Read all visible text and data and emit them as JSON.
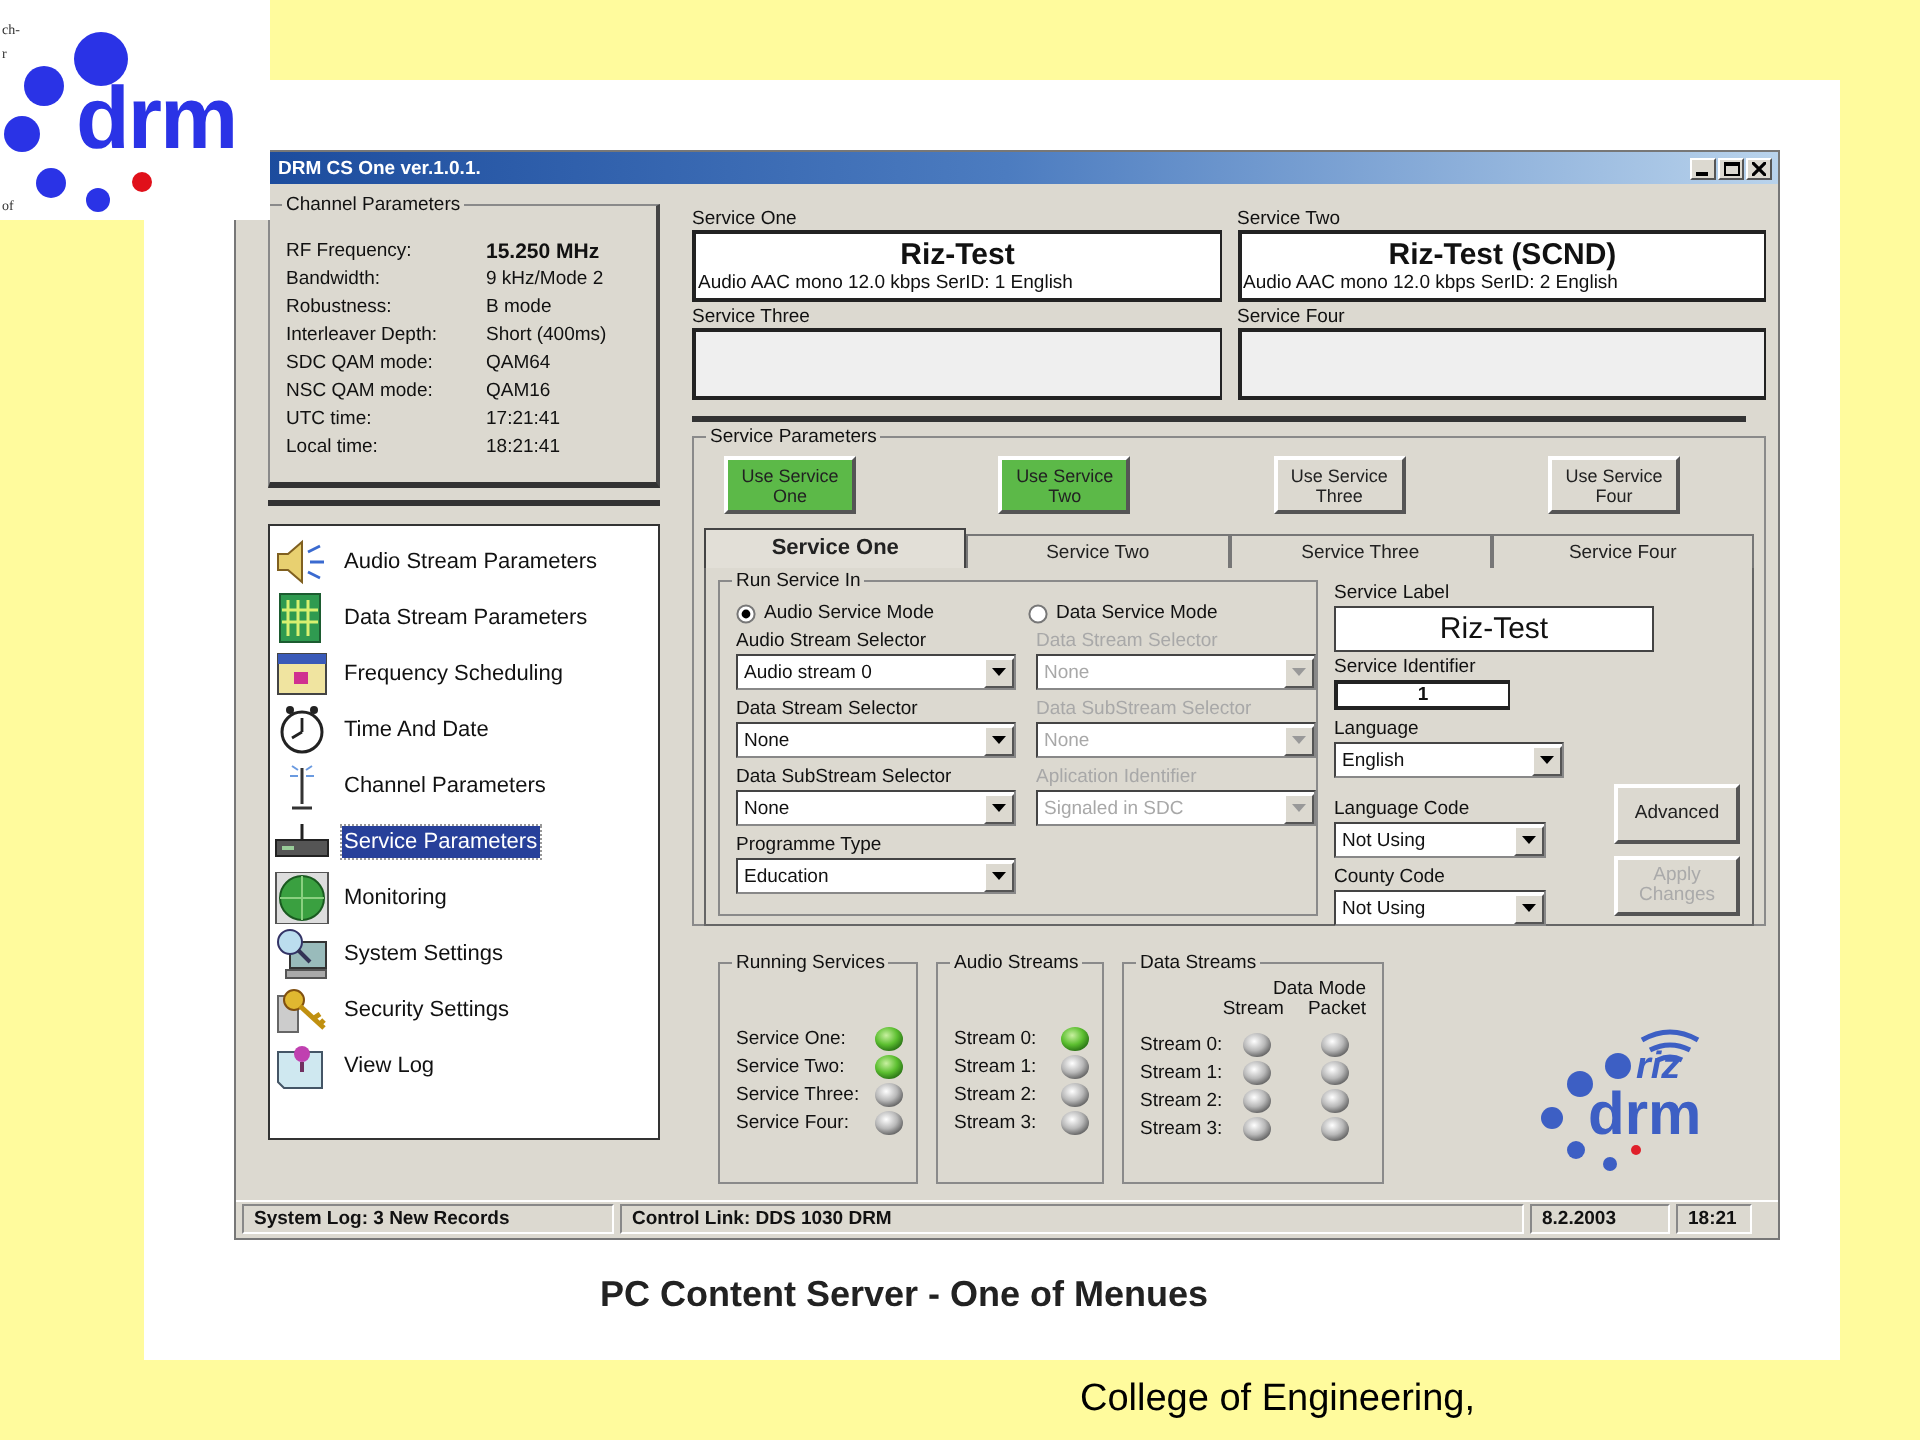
{
  "slide": {
    "logo_fragments": [
      "ch-",
      "r",
      "of"
    ],
    "logo_text": "drm",
    "caption": "PC Content Server - One of Menues",
    "footer": "College of Engineering,"
  },
  "window": {
    "title": "DRM CS One ver.1.0.1."
  },
  "channel_parameters": {
    "title": "Channel Parameters",
    "rows": [
      {
        "label": "RF Frequency:",
        "value": "15.250 MHz",
        "bold": true
      },
      {
        "label": "Bandwidth:",
        "value": "9 kHz/Mode 2",
        "bold": false
      },
      {
        "label": "Robustness:",
        "value": "B mode",
        "bold": false
      },
      {
        "label": "Interleaver Depth:",
        "value": "Short (400ms)",
        "bold": false
      },
      {
        "label": "SDC QAM mode:",
        "value": "QAM64",
        "bold": false
      },
      {
        "label": "NSC QAM mode:",
        "value": "QAM16",
        "bold": false
      },
      {
        "label": "UTC time:",
        "value": "17:21:41",
        "bold": false
      },
      {
        "label": "Local time:",
        "value": "18:21:41",
        "bold": false
      }
    ]
  },
  "navigation": [
    {
      "label": "Audio Stream Parameters",
      "selected": false
    },
    {
      "label": "Data Stream Parameters",
      "selected": false
    },
    {
      "label": "Frequency Scheduling",
      "selected": false
    },
    {
      "label": "Time And Date",
      "selected": false
    },
    {
      "label": "Channel Parameters",
      "selected": false
    },
    {
      "label": "Service Parameters",
      "selected": true
    },
    {
      "label": "Monitoring",
      "selected": false
    },
    {
      "label": "System Settings",
      "selected": false
    },
    {
      "label": "Security Settings",
      "selected": false
    },
    {
      "label": "View Log",
      "selected": false
    }
  ],
  "services": [
    {
      "title": "Service One",
      "active": true,
      "label": "Riz-Test",
      "info": "Audio AAC mono 12.0 kbps SerID: 1 English"
    },
    {
      "title": "Service Two",
      "active": true,
      "label": "Riz-Test (SCND)",
      "info": "Audio AAC mono 12.0 kbps SerID: 2 English"
    },
    {
      "title": "Service Three",
      "active": false
    },
    {
      "title": "Service Four",
      "active": false
    }
  ],
  "service_parameters": {
    "title": "Service Parameters",
    "use_buttons": [
      {
        "label": "Use Service One",
        "on": true
      },
      {
        "label": "Use Service Two",
        "on": true
      },
      {
        "label": "Use Service Three",
        "on": false
      },
      {
        "label": "Use Service Four",
        "on": false
      }
    ],
    "tabs": [
      {
        "label": "Service One",
        "selected": true
      },
      {
        "label": "Service Two",
        "selected": false
      },
      {
        "label": "Service Three",
        "selected": false
      },
      {
        "label": "Service Four",
        "selected": false
      }
    ],
    "run_service_in": {
      "title": "Run Service In",
      "modes": [
        {
          "label": "Audio Service Mode",
          "selected": true
        },
        {
          "label": "Data Service Mode",
          "selected": false
        }
      ],
      "audio_fields": [
        {
          "label": "Audio Stream Selector",
          "value": "Audio stream 0",
          "disabled": false
        },
        {
          "label": "Data Stream Selector",
          "value": "None",
          "disabled": false
        },
        {
          "label": "Data SubStream Selector",
          "value": "None",
          "disabled": false
        },
        {
          "label": "Programme Type",
          "value": "Education",
          "disabled": false
        }
      ],
      "data_fields": [
        {
          "label": "Data Stream Selector",
          "value": "None",
          "disabled": true
        },
        {
          "label": "Data SubStream Selector",
          "value": "None",
          "disabled": true
        },
        {
          "label": "Aplication Identifier",
          "value": "Signaled in SDC",
          "disabled": true
        }
      ]
    },
    "service_label": {
      "label": "Service Label",
      "value": "Riz-Test"
    },
    "service_identifier": {
      "label": "Service Identifier",
      "value": "1"
    },
    "language": {
      "label": "Language",
      "value": "English"
    },
    "language_code": {
      "label": "Language Code",
      "value": "Not Using"
    },
    "country_code": {
      "label": "County Code",
      "value": "Not Using"
    },
    "buttons": [
      {
        "label": "Advanced",
        "disabled": false
      },
      {
        "label": "Apply Changes",
        "disabled": true
      }
    ]
  },
  "running_services": {
    "title": "Running Services",
    "rows": [
      {
        "label": "Service One:",
        "on": true
      },
      {
        "label": "Service Two:",
        "on": true
      },
      {
        "label": "Service Three:",
        "on": false
      },
      {
        "label": "Service Four:",
        "on": false
      }
    ]
  },
  "audio_streams": {
    "title": "Audio Streams",
    "rows": [
      {
        "label": "Stream 0:",
        "on": true
      },
      {
        "label": "Stream 1:",
        "on": false
      },
      {
        "label": "Stream 2:",
        "on": false
      },
      {
        "label": "Stream 3:",
        "on": false
      }
    ]
  },
  "data_streams": {
    "title": "Data Streams",
    "header": "Data Mode",
    "columns": [
      "Stream",
      "Packet"
    ],
    "rows": [
      {
        "label": "Stream 0:",
        "stream": false,
        "packet": false
      },
      {
        "label": "Stream 1:",
        "stream": false,
        "packet": false
      },
      {
        "label": "Stream 2:",
        "stream": false,
        "packet": false
      },
      {
        "label": "Stream 3:",
        "stream": false,
        "packet": false
      }
    ]
  },
  "brand_logo": {
    "top": "riz",
    "bottom": "drm"
  },
  "status_bar": [
    "System Log: 3 New Records",
    "Control Link: DDS 1030 DRM",
    "8.2.2003",
    "18:21"
  ]
}
